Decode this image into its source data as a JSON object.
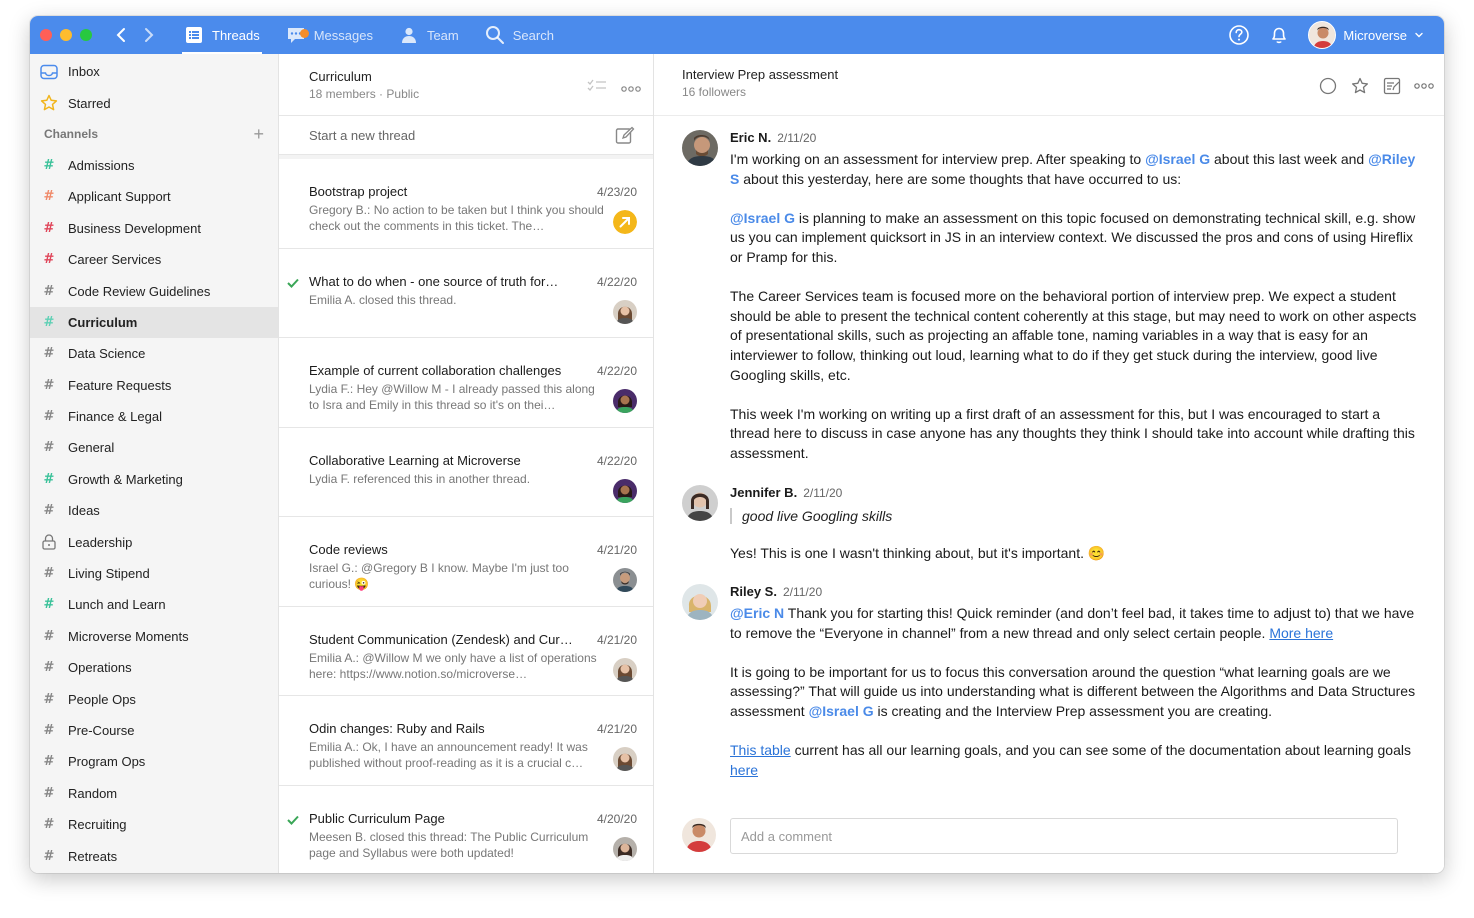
{
  "topbar": {
    "tabs": [
      {
        "label": "Threads",
        "icon": "list-icon",
        "active": true
      },
      {
        "label": "Messages",
        "icon": "chat-bubble-icon",
        "active": false
      },
      {
        "label": "Team",
        "icon": "person-icon",
        "active": false
      },
      {
        "label": "Search",
        "icon": "search-icon",
        "active": false
      }
    ],
    "user": {
      "name": "Microverse"
    },
    "colors": {
      "bar": "#4b8bec",
      "badge": "#f58d2a"
    }
  },
  "sidebar": {
    "inbox": "Inbox",
    "starred": "Starred",
    "channels_header": "Channels",
    "channels": [
      {
        "label": "Admissions",
        "hash_color": "#3cc29a"
      },
      {
        "label": "Applicant Support",
        "hash_color": "#f08a6a"
      },
      {
        "label": "Business Development",
        "hash_color": "#e0475b"
      },
      {
        "label": "Career Services",
        "hash_color": "#e0475b"
      },
      {
        "label": "Code Review Guidelines",
        "hash_color": "#888888"
      },
      {
        "label": "Curriculum",
        "hash_color": "#5fd0b5",
        "active": true
      },
      {
        "label": "Data Science",
        "hash_color": "#888888"
      },
      {
        "label": "Feature Requests",
        "hash_color": "#888888"
      },
      {
        "label": "Finance & Legal",
        "hash_color": "#888888"
      },
      {
        "label": "General",
        "hash_color": "#888888"
      },
      {
        "label": "Growth & Marketing",
        "hash_color": "#3cc29a"
      },
      {
        "label": "Ideas",
        "hash_color": "#888888"
      },
      {
        "label": "Leadership",
        "icon": "lock-icon"
      },
      {
        "label": "Living Stipend",
        "hash_color": "#888888"
      },
      {
        "label": "Lunch and Learn",
        "hash_color": "#3cc29a"
      },
      {
        "label": "Microverse Moments",
        "hash_color": "#888888"
      },
      {
        "label": "Operations",
        "hash_color": "#888888"
      },
      {
        "label": "People Ops",
        "hash_color": "#888888"
      },
      {
        "label": "Pre-Course",
        "hash_color": "#888888"
      },
      {
        "label": "Program Ops",
        "hash_color": "#888888"
      },
      {
        "label": "Random",
        "hash_color": "#888888"
      },
      {
        "label": "Recruiting",
        "hash_color": "#888888"
      },
      {
        "label": "Retreats",
        "hash_color": "#888888"
      }
    ]
  },
  "thread_list": {
    "title": "Curriculum",
    "members": "18 members",
    "visibility": "Public",
    "new_thread_placeholder": "Start a new thread",
    "threads": [
      {
        "title": "Bootstrap project",
        "date": "4/23/20",
        "preview": "Gregory B.: No action to be taken but I think you should check out the comments in this ticket. The…",
        "checked": false,
        "avatar": "yellow-arrow-icon"
      },
      {
        "title": "What to do when - one source of truth for…",
        "date": "4/22/20",
        "preview": "Emilia A. closed this thread.",
        "checked": true,
        "avatar": "emilia"
      },
      {
        "title": "Example of current collaboration challenges",
        "date": "4/22/20",
        "preview": "Lydia F.: Hey @Willow M - I already passed this along to Isra and Emily in this thread so it's on thei…",
        "checked": false,
        "avatar": "lydia"
      },
      {
        "title": "Collaborative Learning at Microverse",
        "date": "4/22/20",
        "preview": "Lydia F. referenced this in another thread.",
        "checked": false,
        "avatar": "lydia"
      },
      {
        "title": "Code reviews",
        "date": "4/21/20",
        "preview": "Israel G.: @Gregory B I know. Maybe I'm just too curious! 😜",
        "checked": false,
        "avatar": "israel"
      },
      {
        "title": "Student Communication (Zendesk) and Cur…",
        "date": "4/21/20",
        "preview": "Emilia A.: @Willow M we only have a list of operations here: https://www.notion.so/microverse…",
        "checked": false,
        "avatar": "emilia"
      },
      {
        "title": "Odin changes: Ruby and Rails",
        "date": "4/21/20",
        "preview": "Emilia A.: Ok, I have an announcement ready! It was published without proof-reading as it is a crucial c…",
        "checked": false,
        "avatar": "emilia"
      },
      {
        "title": "Public Curriculum Page",
        "date": "4/20/20",
        "preview": "Meesen B. closed this thread: The Public Curriculum page and Syllabus were both updated!",
        "checked": true,
        "avatar": "meesen"
      }
    ]
  },
  "detail": {
    "title": "Interview Prep assessment",
    "followers": "16 followers",
    "messages": [
      {
        "author": "Eric N.",
        "date": "2/11/20",
        "p1_a": "I'm working on an assessment for interview prep. After speaking to ",
        "p1_m1": "@Israel G",
        "p1_b": " about this last week and ",
        "p1_m2": "@Riley S",
        "p1_c": " about this yesterday, here are some thoughts that have occurred to us:",
        "p2_m": "@Israel G",
        "p2_a": " is planning to make an assessment on this topic focused on demonstrating technical skill, e.g. show us you can implement quicksort in JS in an interview context. We discussed the pros and cons of using Hireflix or Pramp for this.",
        "p3": "The Career Services team is focused more on the behavioral portion of interview prep. We expect a student should be able to present the technical content coherently at this stage, but may need to work on other aspects of presentational skills, such as projecting an affable tone, naming variables in a way that is easy for an interviewer to follow, thinking out loud, learning what to do if they get stuck during the interview, good live Googling skills, etc.",
        "p4": "This week I'm working on writing up a first draft of an assessment for this, but I was encouraged to start a thread here to discuss in case anyone has any thoughts they think I should take into account while drafting this assessment."
      },
      {
        "author": "Jennifer B.",
        "date": "2/11/20",
        "quote": "good live Googling skills",
        "p1": "Yes! This is one I wasn't thinking about, but it's important. 😊"
      },
      {
        "author": "Riley S.",
        "date": "2/11/20",
        "p1_m": "@Eric N",
        "p1_a": " Thank you for starting this! Quick reminder (and don’t feel bad, it takes time to adjust to) that we have to remove the “Everyone in channel” from a new thread and only select certain people. ",
        "p1_link": "More here",
        "p2_a": "It is going to be important for us to focus this conversation around the question “what learning goals are we assessing?” That will guide us into understanding what is different between the Algorithms and Data Structures assessment ",
        "p2_m": "@Israel G",
        "p2_b": " is creating and the Interview Prep assessment you are creating.",
        "p3_link1": "This table",
        "p3_a": " current has all our learning goals, and you can see some of the documentation about learning goals ",
        "p3_link2": "here"
      }
    ],
    "comment_placeholder": "Add a comment"
  }
}
